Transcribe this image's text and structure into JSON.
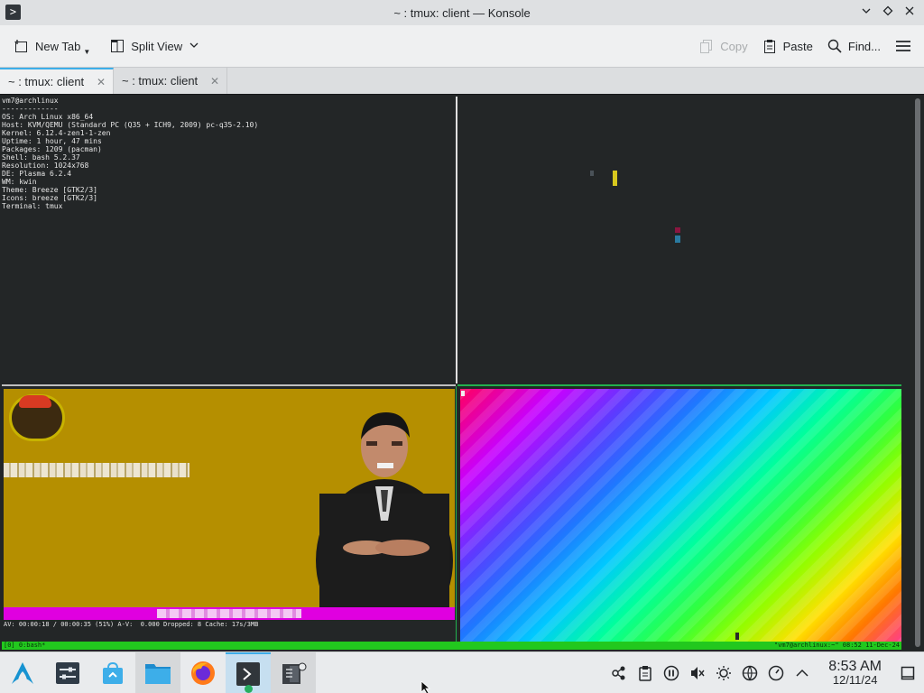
{
  "window": {
    "title": "~ : tmux: client — Konsole"
  },
  "toolbar": {
    "new_tab": "New Tab",
    "split_view": "Split View",
    "copy": "Copy",
    "paste": "Paste",
    "find": "Find..."
  },
  "tabs": [
    {
      "label": "~ : tmux: client",
      "active": true
    },
    {
      "label": "~ : tmux: client",
      "active": false
    }
  ],
  "terminal": {
    "neofetch": [
      "vm7@archlinux",
      "-------------",
      "OS: Arch Linux x86_64",
      "Host: KVM/QEMU (Standard PC (Q35 + ICH9, 2009) pc-q35-2.10)",
      "Kernel: 6.12.4-zen1-1-zen",
      "Uptime: 1 hour, 47 mins",
      "Packages: 1209 (pacman)",
      "Shell: bash 5.2.37",
      "Resolution: 1024x768",
      "DE: Plasma 6.2.4",
      "WM: kwin",
      "Theme: Breeze [GTK2/3]",
      "Icons: breeze [GTK2/3]",
      "Terminal: tmux"
    ],
    "mpv_status": "AV: 00:00:18 / 00:00:35 (51%) A-V:  0.000 Dropped: 8 Cache: 17s/3MB",
    "tmux_left": "[0] 0:bash*",
    "tmux_right": "\"vm7@archlinux:~\" 08:52 11-Dec-24"
  },
  "taskbar": {
    "apps": [
      "application-launcher-icon",
      "system-settings-icon",
      "discover-icon",
      "dolphin-icon",
      "firefox-icon",
      "konsole-icon",
      "mpv-icon"
    ],
    "time": "8:53 AM",
    "date": "12/11/24"
  },
  "colors": {
    "accent": "#3daee9",
    "tmux_status": "#22c81e",
    "terminal_bg": "#232627"
  }
}
